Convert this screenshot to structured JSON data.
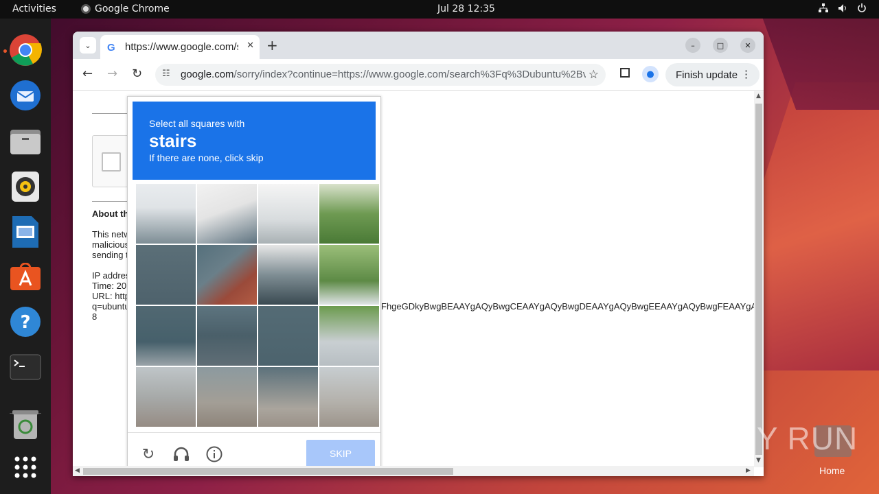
{
  "topbar": {
    "activities": "Activities",
    "app_name": "Google Chrome",
    "clock": "Jul 28  12:35",
    "icons": [
      "network-icon",
      "volume-icon",
      "power-icon"
    ]
  },
  "dock": {
    "items": [
      "chrome",
      "thunderbird",
      "files",
      "rhythmbox",
      "libreoffice-impress",
      "app-center",
      "help",
      "terminal",
      "trash",
      "show-apps"
    ]
  },
  "browser": {
    "tab_title": "https://www.google.com/sorry/index?continue",
    "url_host": "google.com",
    "url_path": "/sorry/index?continue=https://www.google.com/search%3Fq%3Dubuntu%2Bv...",
    "finish_update": "Finish update"
  },
  "page": {
    "about_heading": "About th",
    "para1": "This netw\nmalicious\nsending t",
    "para2": "IP addres\nTime: 20\nURL: http\nq=ubuntu\n8",
    "long_text": "FhgeGDkyBwgBEAAYgAQyBwgCEAAYgAQyBwgDEAAYgAQyBwgEEAAYgAQyBwgFEAAYgA"
  },
  "captcha": {
    "line1": "Select all squares with",
    "target": "stairs",
    "line3": "If there are none, click skip",
    "skip_label": "SKIP"
  },
  "desktop": {
    "watermark": "ANY RUN",
    "home_label": "Home"
  },
  "colors": {
    "captcha_header": "#1a73e8",
    "skip_button": "#a8c7fa"
  }
}
